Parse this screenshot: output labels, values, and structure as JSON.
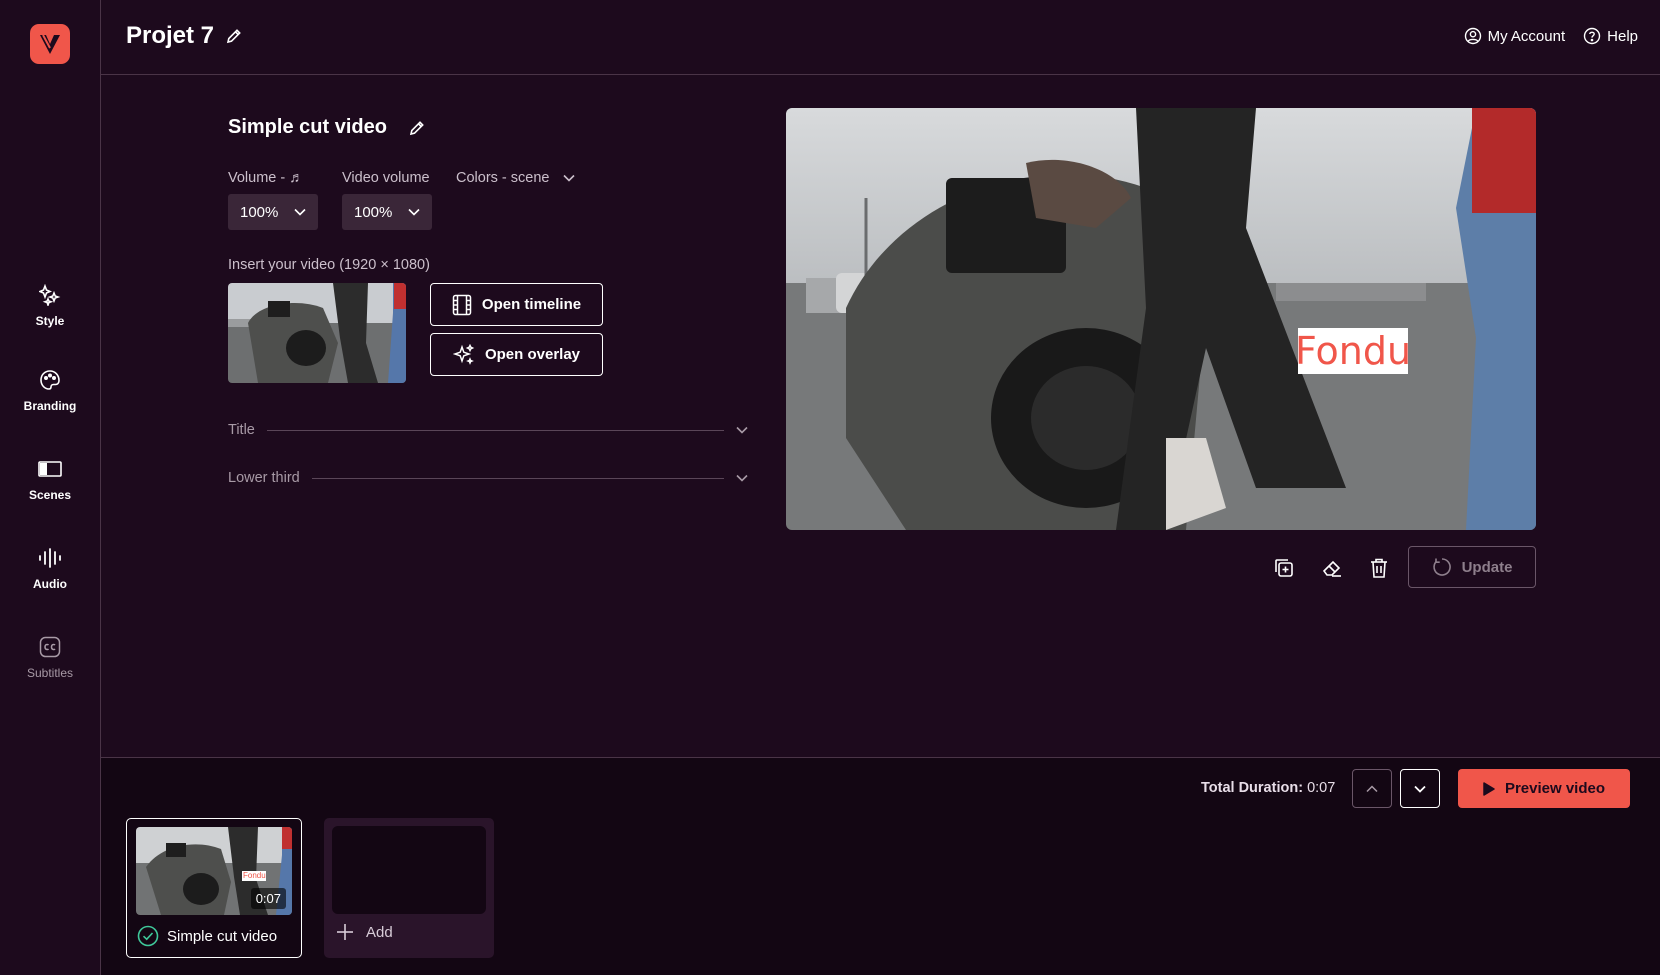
{
  "project": {
    "title": "Projet 7"
  },
  "top_links": {
    "account": "My Account",
    "help": "Help"
  },
  "sidebar": {
    "items": [
      {
        "label": "Style",
        "icon": "sparkles-icon"
      },
      {
        "label": "Branding",
        "icon": "palette-icon"
      },
      {
        "label": "Scenes",
        "icon": "scenes-icon"
      },
      {
        "label": "Audio",
        "icon": "audio-wave-icon"
      },
      {
        "label": "Subtitles",
        "icon": "cc-icon"
      }
    ]
  },
  "scene": {
    "title": "Simple cut video",
    "volume_label": "Volume - ♬",
    "volume_value": "100%",
    "video_volume_label": "Video volume",
    "video_volume_value": "100%",
    "colors_label": "Colors - scene",
    "insert_label": "Insert your video (1920 × 1080)",
    "open_timeline": "Open timeline",
    "open_overlay": "Open overlay",
    "accordions": [
      "Title",
      "Lower third"
    ]
  },
  "preview": {
    "overlay_text": "Fondu"
  },
  "toolbar": {
    "update_label": "Update"
  },
  "footer": {
    "total_duration_label": "Total Duration:",
    "total_duration_value": "0:07",
    "preview_label": "Preview video"
  },
  "scenes_list": [
    {
      "name": "Simple cut video",
      "duration": "0:07",
      "overlay_text": "Fondu"
    }
  ],
  "add_label": "Add",
  "colors": {
    "accent": "#f0564a",
    "bg": "#1d0a1d",
    "panel": "#3a2638",
    "check": "#3fc89a"
  }
}
